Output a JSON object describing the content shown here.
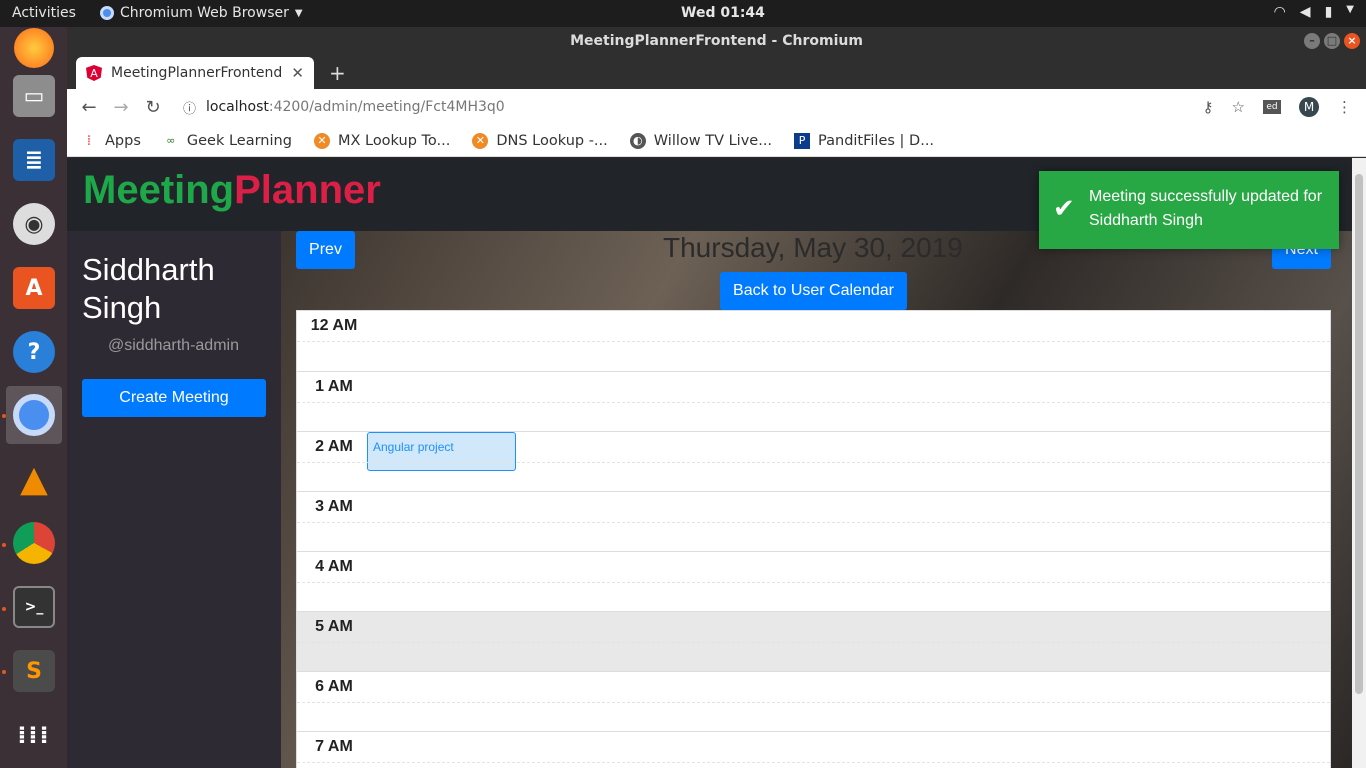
{
  "system": {
    "activities": "Activities",
    "app_menu": "Chromium Web Browser",
    "clock": "Wed 01:44"
  },
  "window": {
    "title": "MeetingPlannerFrontend - Chromium"
  },
  "tab": {
    "title": "MeetingPlannerFrontend"
  },
  "omnibox": {
    "host": "localhost",
    "path": ":4200/admin/meeting/Fct4MH3q0"
  },
  "profile": {
    "initial": "M"
  },
  "extension": {
    "label": "ed"
  },
  "bookmarks": [
    {
      "label": "Apps",
      "icon": "apps-grid-icon"
    },
    {
      "label": "Geek Learning",
      "icon": "geek-icon"
    },
    {
      "label": "MX Lookup To...",
      "icon": "mx-lookup-icon"
    },
    {
      "label": "DNS Lookup -...",
      "icon": "dns-lookup-icon"
    },
    {
      "label": "Willow TV Live...",
      "icon": "globe-icon"
    },
    {
      "label": "PanditFiles | D...",
      "icon": "panditfiles-icon"
    }
  ],
  "app": {
    "brand_part1": "Meeting",
    "brand_part2": "Planner",
    "brand_color1": "#1ea84a",
    "brand_color2": "#dc1f46"
  },
  "sidebar": {
    "user_name": "Siddharth Singh",
    "user_handle": "@siddharth-admin",
    "create_meeting": "Create Meeting"
  },
  "calendar": {
    "prev": "Prev",
    "next": "Next",
    "date_title": "Thursday, May 30, 2019",
    "back_button": "Back to User Calendar",
    "hours": [
      "12 AM",
      "1 AM",
      "2 AM",
      "3 AM",
      "4 AM",
      "5 AM",
      "6 AM",
      "7 AM"
    ],
    "event": {
      "title": "Angular project",
      "hour": "2 AM"
    }
  },
  "toast": {
    "message": "Meeting successfully updated for Siddharth Singh",
    "color": "#28a745"
  }
}
